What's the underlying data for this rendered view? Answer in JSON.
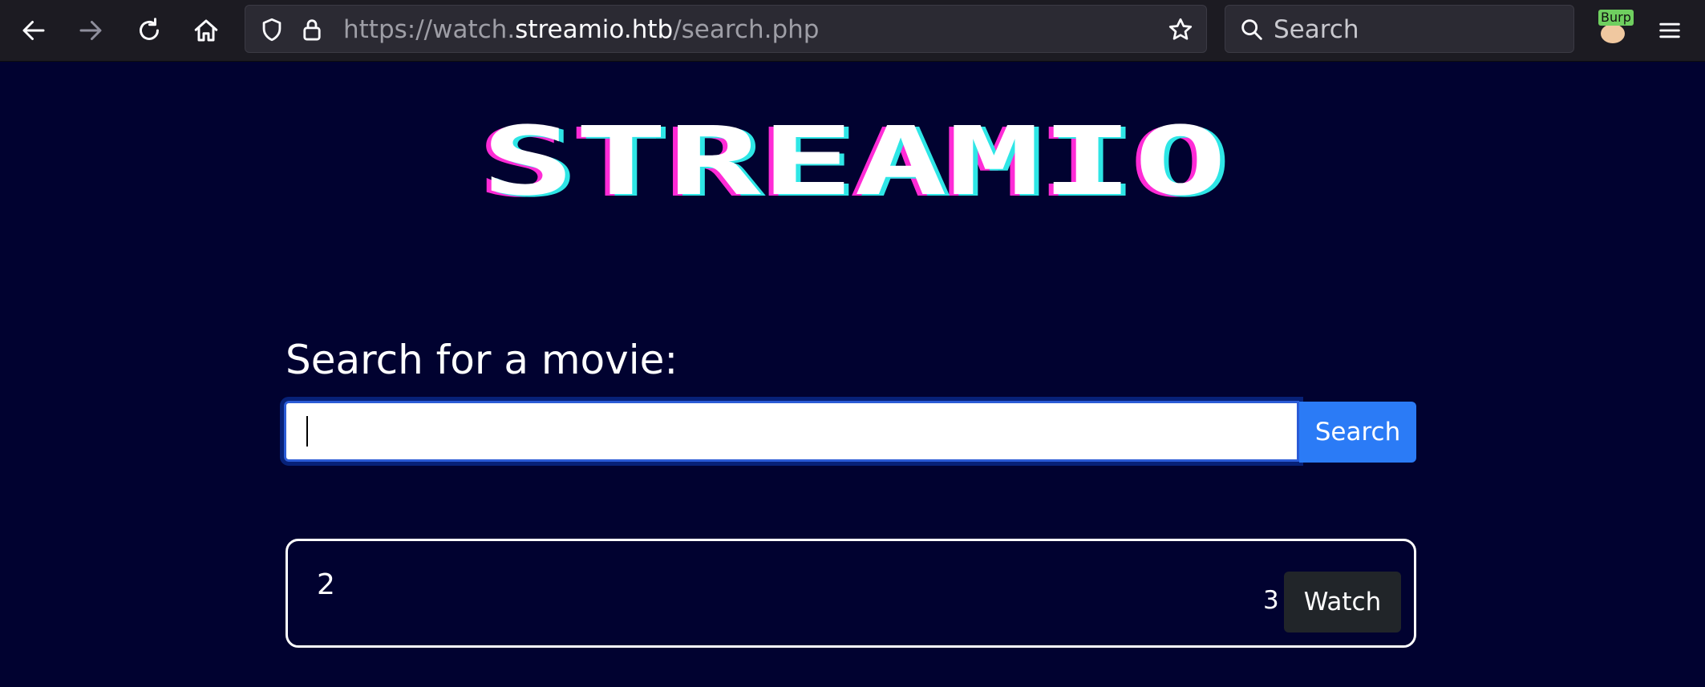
{
  "browser": {
    "url_prefix": "https://watch.",
    "url_host": "streamio.htb",
    "url_path": "/search.php",
    "search_placeholder": "Search",
    "extension_badge": "Burp"
  },
  "page": {
    "logo_text": "STREAMIO",
    "search_label": "Search for a movie:",
    "search_value": "",
    "search_button": "Search",
    "results": [
      {
        "title": "2",
        "meta": "3",
        "action": "Watch"
      }
    ],
    "colors": {
      "background": "#010230",
      "accent": "#2b7bf6",
      "logo_pink": "#ff2bd6",
      "logo_cyan": "#2ee6e6"
    }
  }
}
